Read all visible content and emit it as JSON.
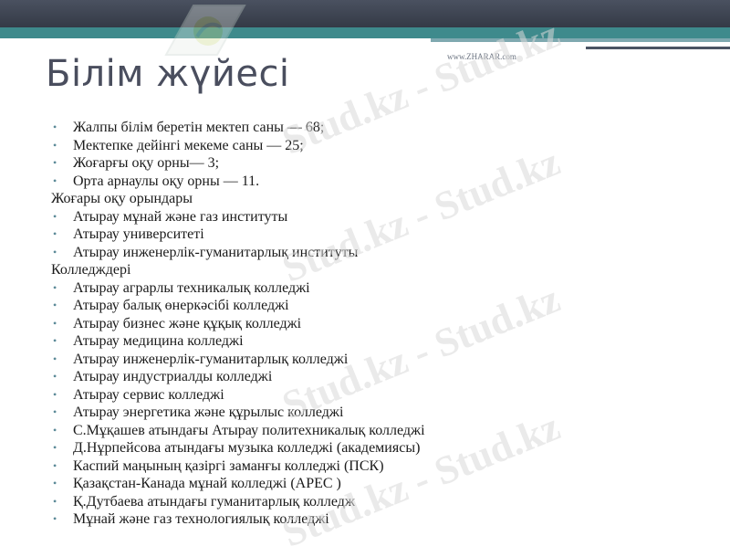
{
  "header": {
    "site_mark": "www.ZHARAR.com"
  },
  "slide": {
    "title": "Білім жүйесі",
    "watermark_text": "Stud.kz - Stud.kz",
    "items": [
      {
        "text": "Жалпы білім беретін мектеп саны — 68;",
        "bullet": true
      },
      {
        "text": "Мектепке дейінгі мекеме саны — 25;",
        "bullet": true
      },
      {
        "text": "Жоғарғы оқу орны— 3;",
        "bullet": true
      },
      {
        "text": "Орта арнаулы оқу орны — 11.",
        "bullet": true
      },
      {
        "text": "Жоғары оқу орындары",
        "bullet": false
      },
      {
        "text": "Атырау мұнай және газ институты",
        "bullet": true
      },
      {
        "text": "Атырау университеті",
        "bullet": true
      },
      {
        "text": "Атырау инженерлік-гуманитарлық институты",
        "bullet": true
      },
      {
        "text": "Колледждері",
        "bullet": false
      },
      {
        "text": "Атырау аграрлы техникалық колледжі",
        "bullet": true
      },
      {
        "text": "Атырау балық өнеркәсібі колледжі",
        "bullet": true
      },
      {
        "text": "Атырау бизнес және құқық колледжі",
        "bullet": true
      },
      {
        "text": "Атырау медицина колледжі",
        "bullet": true
      },
      {
        "text": "Атырау инженерлік-гуманитарлық колледжі",
        "bullet": true
      },
      {
        "text": "Атырау индустриалды колледжі",
        "bullet": true
      },
      {
        "text": "Атырау сервис колледжі",
        "bullet": true
      },
      {
        "text": "Атырау энергетика және құрылыс колледжі",
        "bullet": true
      },
      {
        "text": "С.Мұқашев атындағы Атырау политехникалық колледжі",
        "bullet": true
      },
      {
        "text": "Д.Нұрпейсова атындағы музыка колледжі (академиясы)",
        "bullet": true
      },
      {
        "text": "Каспий маңының қазіргі заманғы колледжі (ПСК)",
        "bullet": true
      },
      {
        "text": "Қазақстан-Канада мұнай колледжі (APEC )",
        "bullet": true
      },
      {
        "text": "Қ.Дутбаева атындағы гуманитарлық колледж",
        "bullet": true
      },
      {
        "text": "Мұнай және газ технологиялық колледжі",
        "bullet": true
      }
    ]
  },
  "colors": {
    "top_bar": "#343a46",
    "teal_band": "#3e8a8c",
    "title": "#4a4e5e",
    "bullet": "#5c8a98"
  }
}
